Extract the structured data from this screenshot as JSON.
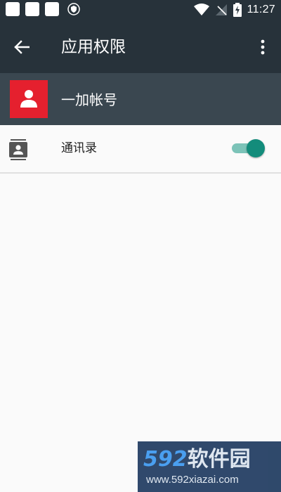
{
  "status_bar": {
    "time": "11:27"
  },
  "app_bar": {
    "title": "应用权限"
  },
  "app": {
    "name": "一加帐号",
    "icon_color": "#e5202e"
  },
  "permissions": [
    {
      "label": "通讯录",
      "enabled": true
    }
  ],
  "colors": {
    "toolbar": "#27323a",
    "app_row": "#3a4750",
    "accent": "#138c7b"
  },
  "watermark": {
    "brand_number": "592",
    "brand_text": "软件园",
    "url": "www.592xiazai.com"
  }
}
